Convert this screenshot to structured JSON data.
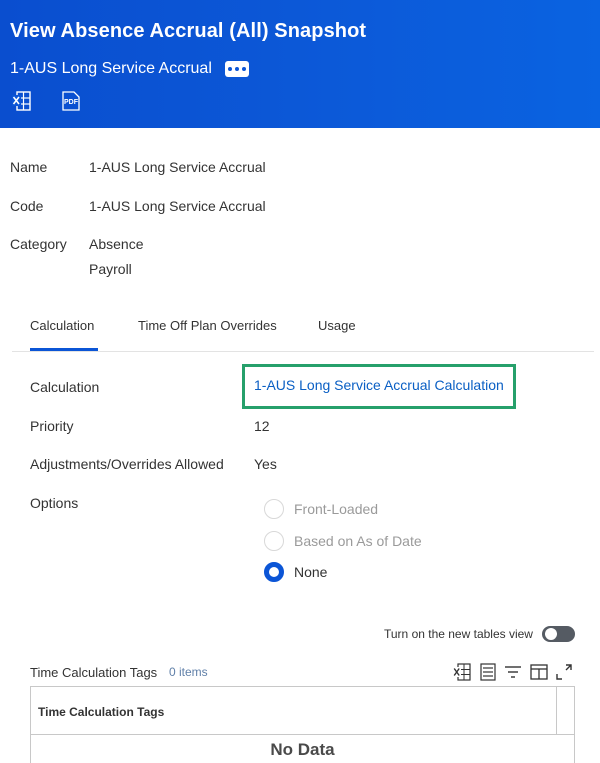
{
  "header": {
    "title": "View Absence Accrual (All) Snapshot",
    "subtitle": "1-AUS Long Service Accrual",
    "colors": {
      "background": "#0b55d6",
      "text": "#ffffff"
    },
    "actions": [
      {
        "icon": "excel-export-icon"
      },
      {
        "icon": "pdf-export-icon",
        "text": "PDF"
      }
    ]
  },
  "details": {
    "name_label": "Name",
    "name_value": "1-AUS Long Service Accrual",
    "code_label": "Code",
    "code_value": "1-AUS Long Service Accrual",
    "category_label": "Category",
    "category_values": [
      "Absence",
      "Payroll"
    ]
  },
  "tabs": [
    {
      "label": "Calculation",
      "active": true
    },
    {
      "label": "Time Off Plan Overrides",
      "active": false
    },
    {
      "label": "Usage",
      "active": false
    }
  ],
  "calculation": {
    "calculation_label": "Calculation",
    "calculation_link": "1-AUS Long Service Accrual Calculation",
    "priority_label": "Priority",
    "priority_value": "12",
    "adjustments_label": "Adjustments/Overrides Allowed",
    "adjustments_value": "Yes",
    "options_label": "Options",
    "options": [
      {
        "label": "Front-Loaded",
        "selected": false
      },
      {
        "label": "Based on As of Date",
        "selected": false
      },
      {
        "label": "None",
        "selected": true
      }
    ],
    "highlight_color": "#26a06b",
    "link_color": "#0a5fc4"
  },
  "tables_toggle": {
    "label": "Turn on the new tables view",
    "on": false
  },
  "grid": {
    "title": "Time Calculation Tags",
    "count": "0 items",
    "tools": [
      "excel-export-icon",
      "grid-view-icon",
      "filter-icon",
      "columns-icon",
      "fullscreen-icon"
    ],
    "column_header": "Time Calculation Tags",
    "empty_text": "No Data"
  }
}
